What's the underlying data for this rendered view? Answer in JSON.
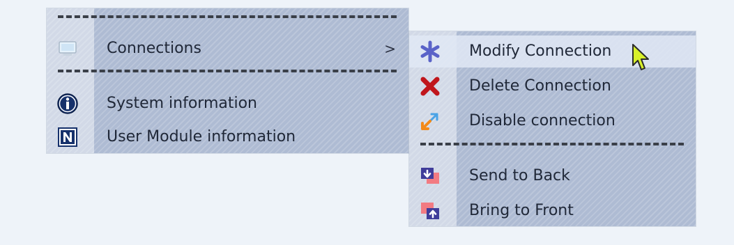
{
  "main_menu": {
    "items": [
      {
        "label": "Connections",
        "icon": "monitor-icon",
        "submenu_indicator": ">"
      },
      {
        "label": "System information",
        "icon": "info-icon"
      },
      {
        "label": "User Module information",
        "icon": "n-module-icon"
      }
    ]
  },
  "sub_menu": {
    "items": [
      {
        "label": "Modify Connection",
        "icon": "asterisk-icon"
      },
      {
        "label": "Delete Connection",
        "icon": "delete-x-icon"
      },
      {
        "label": "Disable connection",
        "icon": "disable-arrows-icon"
      },
      {
        "label": "Send to Back",
        "icon": "send-to-back-icon"
      },
      {
        "label": "Bring to Front",
        "icon": "bring-to-front-icon"
      }
    ]
  },
  "colors": {
    "menu_background": "#aebbd3",
    "page_background": "#eef3f9",
    "asterisk": "#5a63c8",
    "delete": "#c0161c",
    "cursor": "#d8f02a"
  }
}
